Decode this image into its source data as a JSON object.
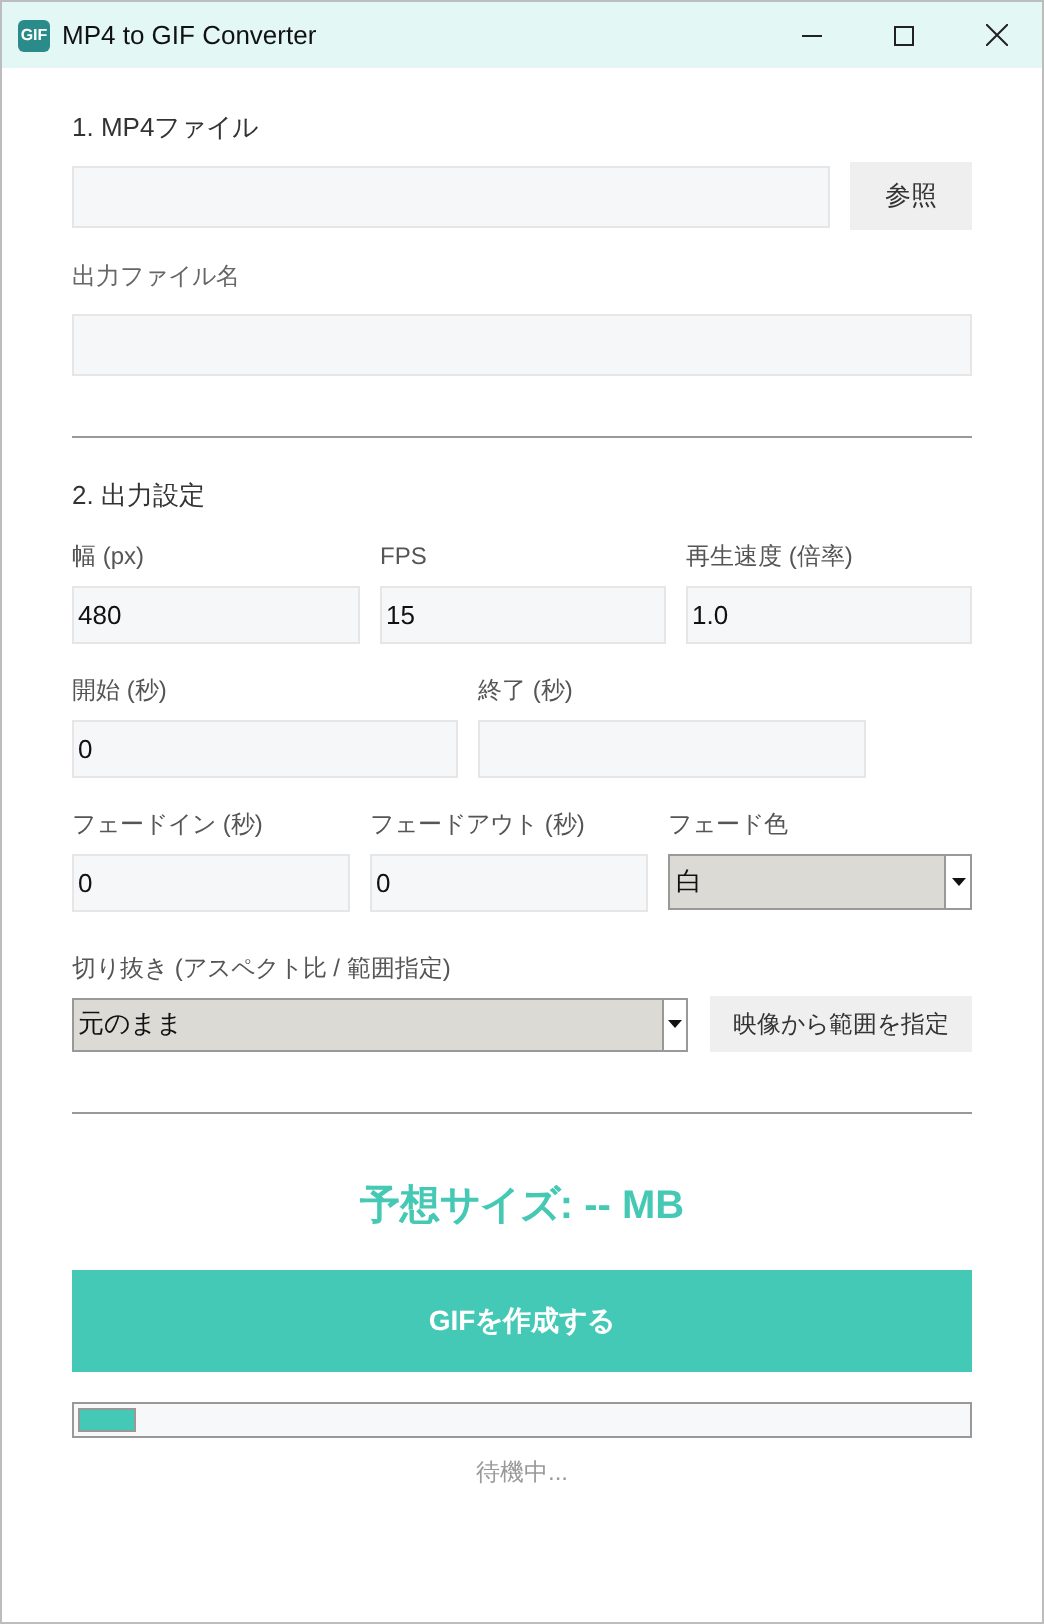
{
  "window": {
    "title": "MP4 to GIF Converter",
    "icon_text": "GIF"
  },
  "file_section": {
    "title": "1. MP4ファイル",
    "browse_button": "参照",
    "output_label": "出力ファイル名"
  },
  "settings_section": {
    "title": "2. 出力設定",
    "rows": [
      [
        {
          "kind": "input",
          "label": "幅 (px)",
          "value": "480"
        },
        {
          "kind": "input",
          "label": "FPS",
          "value": "15"
        },
        {
          "kind": "input",
          "label": "再生速度 (倍率)",
          "value": "1.0"
        }
      ],
      [
        {
          "kind": "input",
          "label": "開始 (秒)",
          "value": "0"
        },
        {
          "kind": "input",
          "label": "終了 (秒)"
        }
      ],
      [
        {
          "kind": "input",
          "label": "フェードイン (秒)",
          "value": "0"
        },
        {
          "kind": "input",
          "label": "フェードアウト (秒)",
          "value": "0"
        },
        {
          "kind": "select",
          "label": "フェード色",
          "value": "白"
        }
      ]
    ],
    "crop_label": "切り抜き (アスペクト比 / 範囲指定)",
    "crop_value": "元のまま",
    "crop_button": "映像から範囲を指定"
  },
  "estimate": "予想サイズ: -- MB",
  "create_button": "GIFを作成する",
  "progress": {
    "level": 0.065
  },
  "status": "待機中..."
}
